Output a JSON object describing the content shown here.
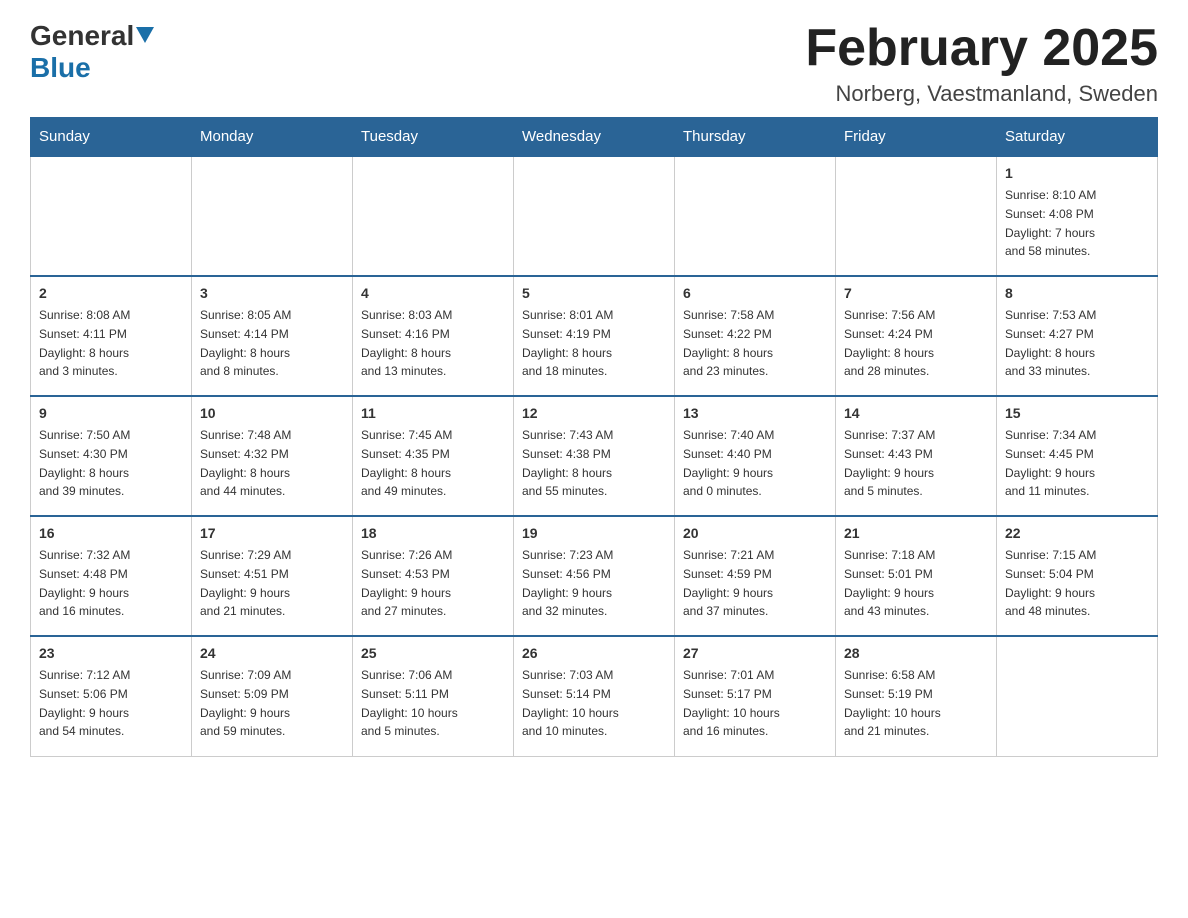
{
  "header": {
    "logo": {
      "general": "General",
      "blue": "Blue"
    },
    "title": "February 2025",
    "location": "Norberg, Vaestmanland, Sweden"
  },
  "days_of_week": [
    "Sunday",
    "Monday",
    "Tuesday",
    "Wednesday",
    "Thursday",
    "Friday",
    "Saturday"
  ],
  "weeks": [
    [
      {
        "day": "",
        "info": ""
      },
      {
        "day": "",
        "info": ""
      },
      {
        "day": "",
        "info": ""
      },
      {
        "day": "",
        "info": ""
      },
      {
        "day": "",
        "info": ""
      },
      {
        "day": "",
        "info": ""
      },
      {
        "day": "1",
        "info": "Sunrise: 8:10 AM\nSunset: 4:08 PM\nDaylight: 7 hours\nand 58 minutes."
      }
    ],
    [
      {
        "day": "2",
        "info": "Sunrise: 8:08 AM\nSunset: 4:11 PM\nDaylight: 8 hours\nand 3 minutes."
      },
      {
        "day": "3",
        "info": "Sunrise: 8:05 AM\nSunset: 4:14 PM\nDaylight: 8 hours\nand 8 minutes."
      },
      {
        "day": "4",
        "info": "Sunrise: 8:03 AM\nSunset: 4:16 PM\nDaylight: 8 hours\nand 13 minutes."
      },
      {
        "day": "5",
        "info": "Sunrise: 8:01 AM\nSunset: 4:19 PM\nDaylight: 8 hours\nand 18 minutes."
      },
      {
        "day": "6",
        "info": "Sunrise: 7:58 AM\nSunset: 4:22 PM\nDaylight: 8 hours\nand 23 minutes."
      },
      {
        "day": "7",
        "info": "Sunrise: 7:56 AM\nSunset: 4:24 PM\nDaylight: 8 hours\nand 28 minutes."
      },
      {
        "day": "8",
        "info": "Sunrise: 7:53 AM\nSunset: 4:27 PM\nDaylight: 8 hours\nand 33 minutes."
      }
    ],
    [
      {
        "day": "9",
        "info": "Sunrise: 7:50 AM\nSunset: 4:30 PM\nDaylight: 8 hours\nand 39 minutes."
      },
      {
        "day": "10",
        "info": "Sunrise: 7:48 AM\nSunset: 4:32 PM\nDaylight: 8 hours\nand 44 minutes."
      },
      {
        "day": "11",
        "info": "Sunrise: 7:45 AM\nSunset: 4:35 PM\nDaylight: 8 hours\nand 49 minutes."
      },
      {
        "day": "12",
        "info": "Sunrise: 7:43 AM\nSunset: 4:38 PM\nDaylight: 8 hours\nand 55 minutes."
      },
      {
        "day": "13",
        "info": "Sunrise: 7:40 AM\nSunset: 4:40 PM\nDaylight: 9 hours\nand 0 minutes."
      },
      {
        "day": "14",
        "info": "Sunrise: 7:37 AM\nSunset: 4:43 PM\nDaylight: 9 hours\nand 5 minutes."
      },
      {
        "day": "15",
        "info": "Sunrise: 7:34 AM\nSunset: 4:45 PM\nDaylight: 9 hours\nand 11 minutes."
      }
    ],
    [
      {
        "day": "16",
        "info": "Sunrise: 7:32 AM\nSunset: 4:48 PM\nDaylight: 9 hours\nand 16 minutes."
      },
      {
        "day": "17",
        "info": "Sunrise: 7:29 AM\nSunset: 4:51 PM\nDaylight: 9 hours\nand 21 minutes."
      },
      {
        "day": "18",
        "info": "Sunrise: 7:26 AM\nSunset: 4:53 PM\nDaylight: 9 hours\nand 27 minutes."
      },
      {
        "day": "19",
        "info": "Sunrise: 7:23 AM\nSunset: 4:56 PM\nDaylight: 9 hours\nand 32 minutes."
      },
      {
        "day": "20",
        "info": "Sunrise: 7:21 AM\nSunset: 4:59 PM\nDaylight: 9 hours\nand 37 minutes."
      },
      {
        "day": "21",
        "info": "Sunrise: 7:18 AM\nSunset: 5:01 PM\nDaylight: 9 hours\nand 43 minutes."
      },
      {
        "day": "22",
        "info": "Sunrise: 7:15 AM\nSunset: 5:04 PM\nDaylight: 9 hours\nand 48 minutes."
      }
    ],
    [
      {
        "day": "23",
        "info": "Sunrise: 7:12 AM\nSunset: 5:06 PM\nDaylight: 9 hours\nand 54 minutes."
      },
      {
        "day": "24",
        "info": "Sunrise: 7:09 AM\nSunset: 5:09 PM\nDaylight: 9 hours\nand 59 minutes."
      },
      {
        "day": "25",
        "info": "Sunrise: 7:06 AM\nSunset: 5:11 PM\nDaylight: 10 hours\nand 5 minutes."
      },
      {
        "day": "26",
        "info": "Sunrise: 7:03 AM\nSunset: 5:14 PM\nDaylight: 10 hours\nand 10 minutes."
      },
      {
        "day": "27",
        "info": "Sunrise: 7:01 AM\nSunset: 5:17 PM\nDaylight: 10 hours\nand 16 minutes."
      },
      {
        "day": "28",
        "info": "Sunrise: 6:58 AM\nSunset: 5:19 PM\nDaylight: 10 hours\nand 21 minutes."
      },
      {
        "day": "",
        "info": ""
      }
    ]
  ]
}
